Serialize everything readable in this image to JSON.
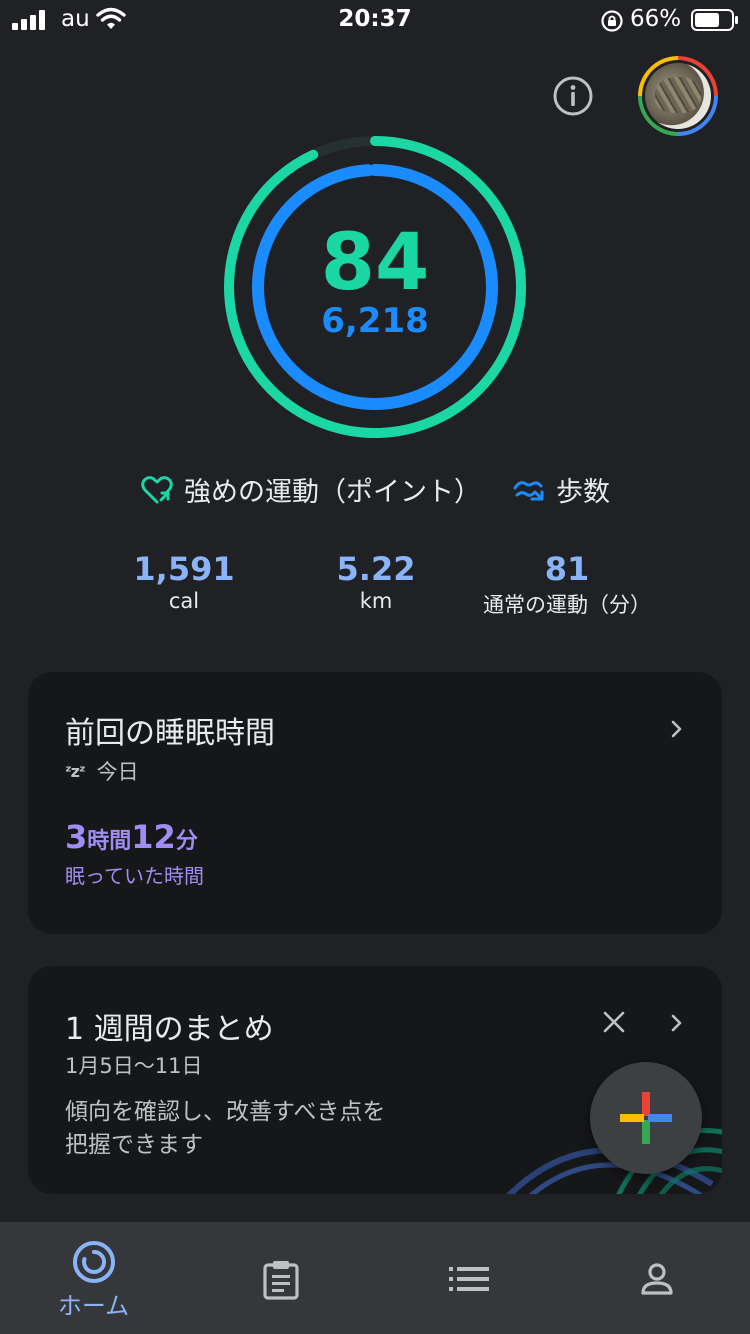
{
  "status_bar": {
    "carrier": "au",
    "time": "20:37",
    "battery": "66%"
  },
  "rings": {
    "heart_points": "84",
    "steps": "6,218",
    "heart_points_progress": 0.93,
    "steps_progress": 0.99,
    "outer_color": "#1bd7a4",
    "inner_color": "#1a8cff"
  },
  "legend": {
    "heart_points_label": "強めの運動（ポイント）",
    "steps_label": "歩数"
  },
  "stats": [
    {
      "value": "1,591",
      "unit": "cal"
    },
    {
      "value": "5.22",
      "unit": "km"
    },
    {
      "value": "81",
      "unit": "通常の運動（分）"
    }
  ],
  "sleep_card": {
    "title": "前回の睡眠時間",
    "day": "今日",
    "hours_value": "3",
    "hours_unit": "時間",
    "minutes_value": "12",
    "minutes_unit": "分",
    "label": "眠っていた時間"
  },
  "weekly_card": {
    "title": "1 週間のまとめ",
    "dates": "1月5日～11日",
    "description_line1": "傾向を確認し、改善すべき点を",
    "description_line2": "把握できます"
  },
  "bottom_nav": {
    "home_label": "ホーム",
    "active": "home"
  },
  "colors": {
    "background": "#202124",
    "card": "#161719",
    "accent_blue": "#8ab4f8",
    "sleep_purple": "#a08cf2"
  }
}
